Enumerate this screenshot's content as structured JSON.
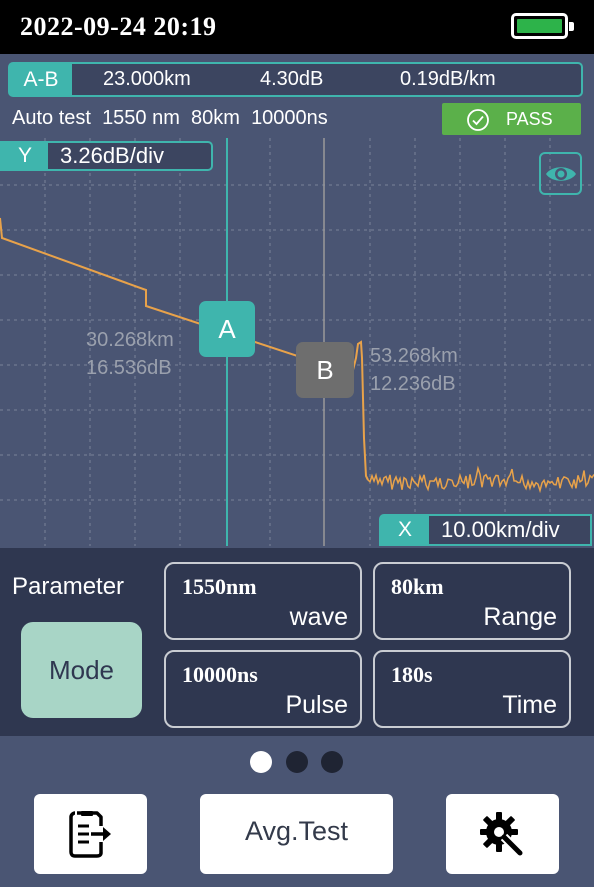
{
  "status_bar": {
    "datetime": "2022-09-24 20:19",
    "battery_icon": "battery-full-icon",
    "battery_color": "#2db34a"
  },
  "ab_info": {
    "label": "A-B",
    "distance": "23.000km",
    "loss": "4.30dB",
    "attenuation": "0.19dB/km"
  },
  "test_info": {
    "mode": "Auto test",
    "wavelength": "1550 nm",
    "range": "80km",
    "pulse": "10000ns"
  },
  "result": {
    "label": "PASS",
    "icon": "check-circle-icon",
    "color": "#5bb04a"
  },
  "y_scale": {
    "label": "Y",
    "value": "3.26dB/div"
  },
  "x_scale": {
    "label": "X",
    "value": "10.00km/div"
  },
  "view_toggle": {
    "icon": "eye-icon"
  },
  "cursor_a": {
    "label": "A",
    "distance": "30.268km",
    "loss": "16.536dB"
  },
  "cursor_b": {
    "label": "B",
    "distance": "53.268km",
    "loss": "12.236dB"
  },
  "parameters": {
    "title": "Parameter",
    "mode_button": "Mode",
    "wave": {
      "value": "1550nm",
      "label": "wave"
    },
    "range": {
      "value": "80km",
      "label": "Range"
    },
    "pulse": {
      "value": "10000ns",
      "label": "Pulse"
    },
    "time": {
      "value": "180s",
      "label": "Time"
    }
  },
  "pager": {
    "count": 3,
    "active": 0
  },
  "bottom_bar": {
    "export_icon": "export-file-icon",
    "avg_test_label": "Avg.Test",
    "settings_icon": "settings-gear-wrench-icon"
  },
  "colors": {
    "accent": "#3fb5ad",
    "trace": "#e8a24a",
    "background": "#4a5573"
  }
}
